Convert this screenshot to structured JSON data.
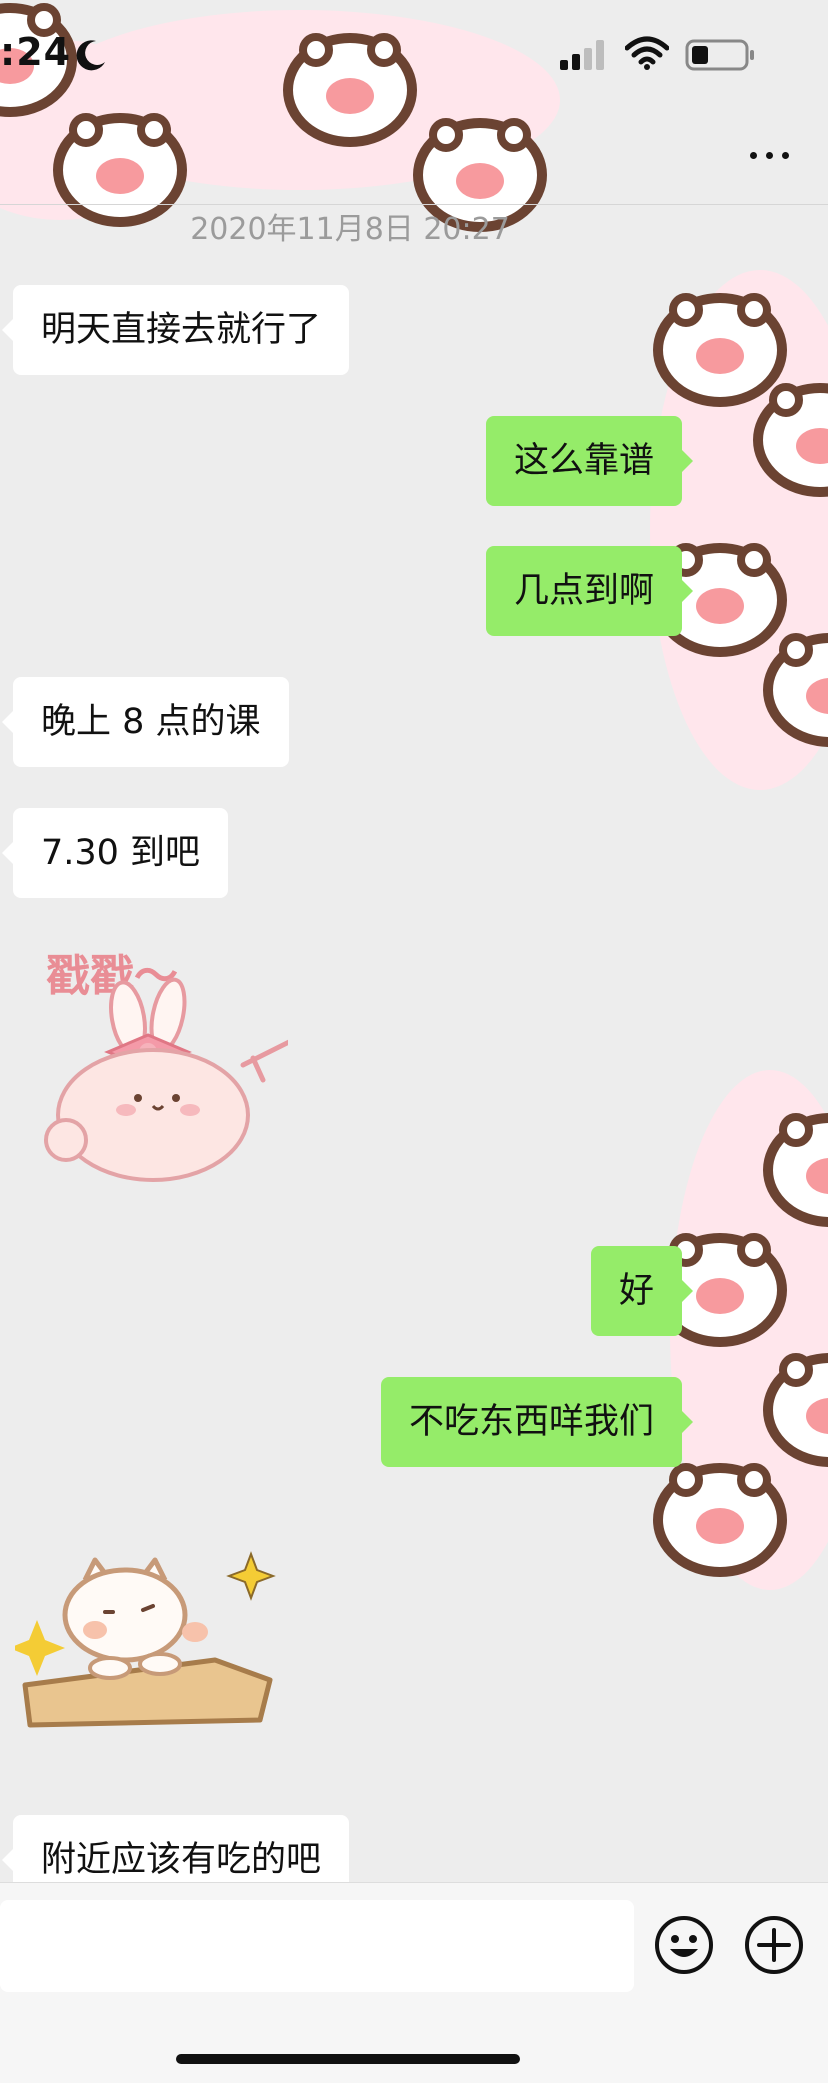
{
  "status_bar": {
    "time": ":24"
  },
  "chat": {
    "timestamp": "2020年11月8日 20:27",
    "messages": [
      {
        "side": "left",
        "text": "明天直接去就行了"
      },
      {
        "side": "right",
        "text": "这么靠谱"
      },
      {
        "side": "right",
        "text": "几点到啊"
      },
      {
        "side": "left",
        "text": "晚上 8 点的课"
      },
      {
        "side": "left",
        "text": "7.30 到吧"
      },
      {
        "side": "right",
        "text": "好"
      },
      {
        "side": "right",
        "text": "不吃东西咩我们"
      },
      {
        "side": "left",
        "text": "附近应该有吃的吧"
      }
    ],
    "sticker_poke": {
      "text": "戳戳～"
    }
  },
  "colors": {
    "background": "#ededed",
    "bubble_left": "#ffffff",
    "bubble_right": "#95ec69",
    "timestamp": "#9b9b9b",
    "paw_pink": "#ffe6ec",
    "paw_outline": "#6b4332"
  },
  "icons": [
    "moon-icon",
    "cellular-signal-icon",
    "wifi-icon",
    "battery-icon",
    "more-icon",
    "emoji-icon",
    "plus-icon"
  ]
}
